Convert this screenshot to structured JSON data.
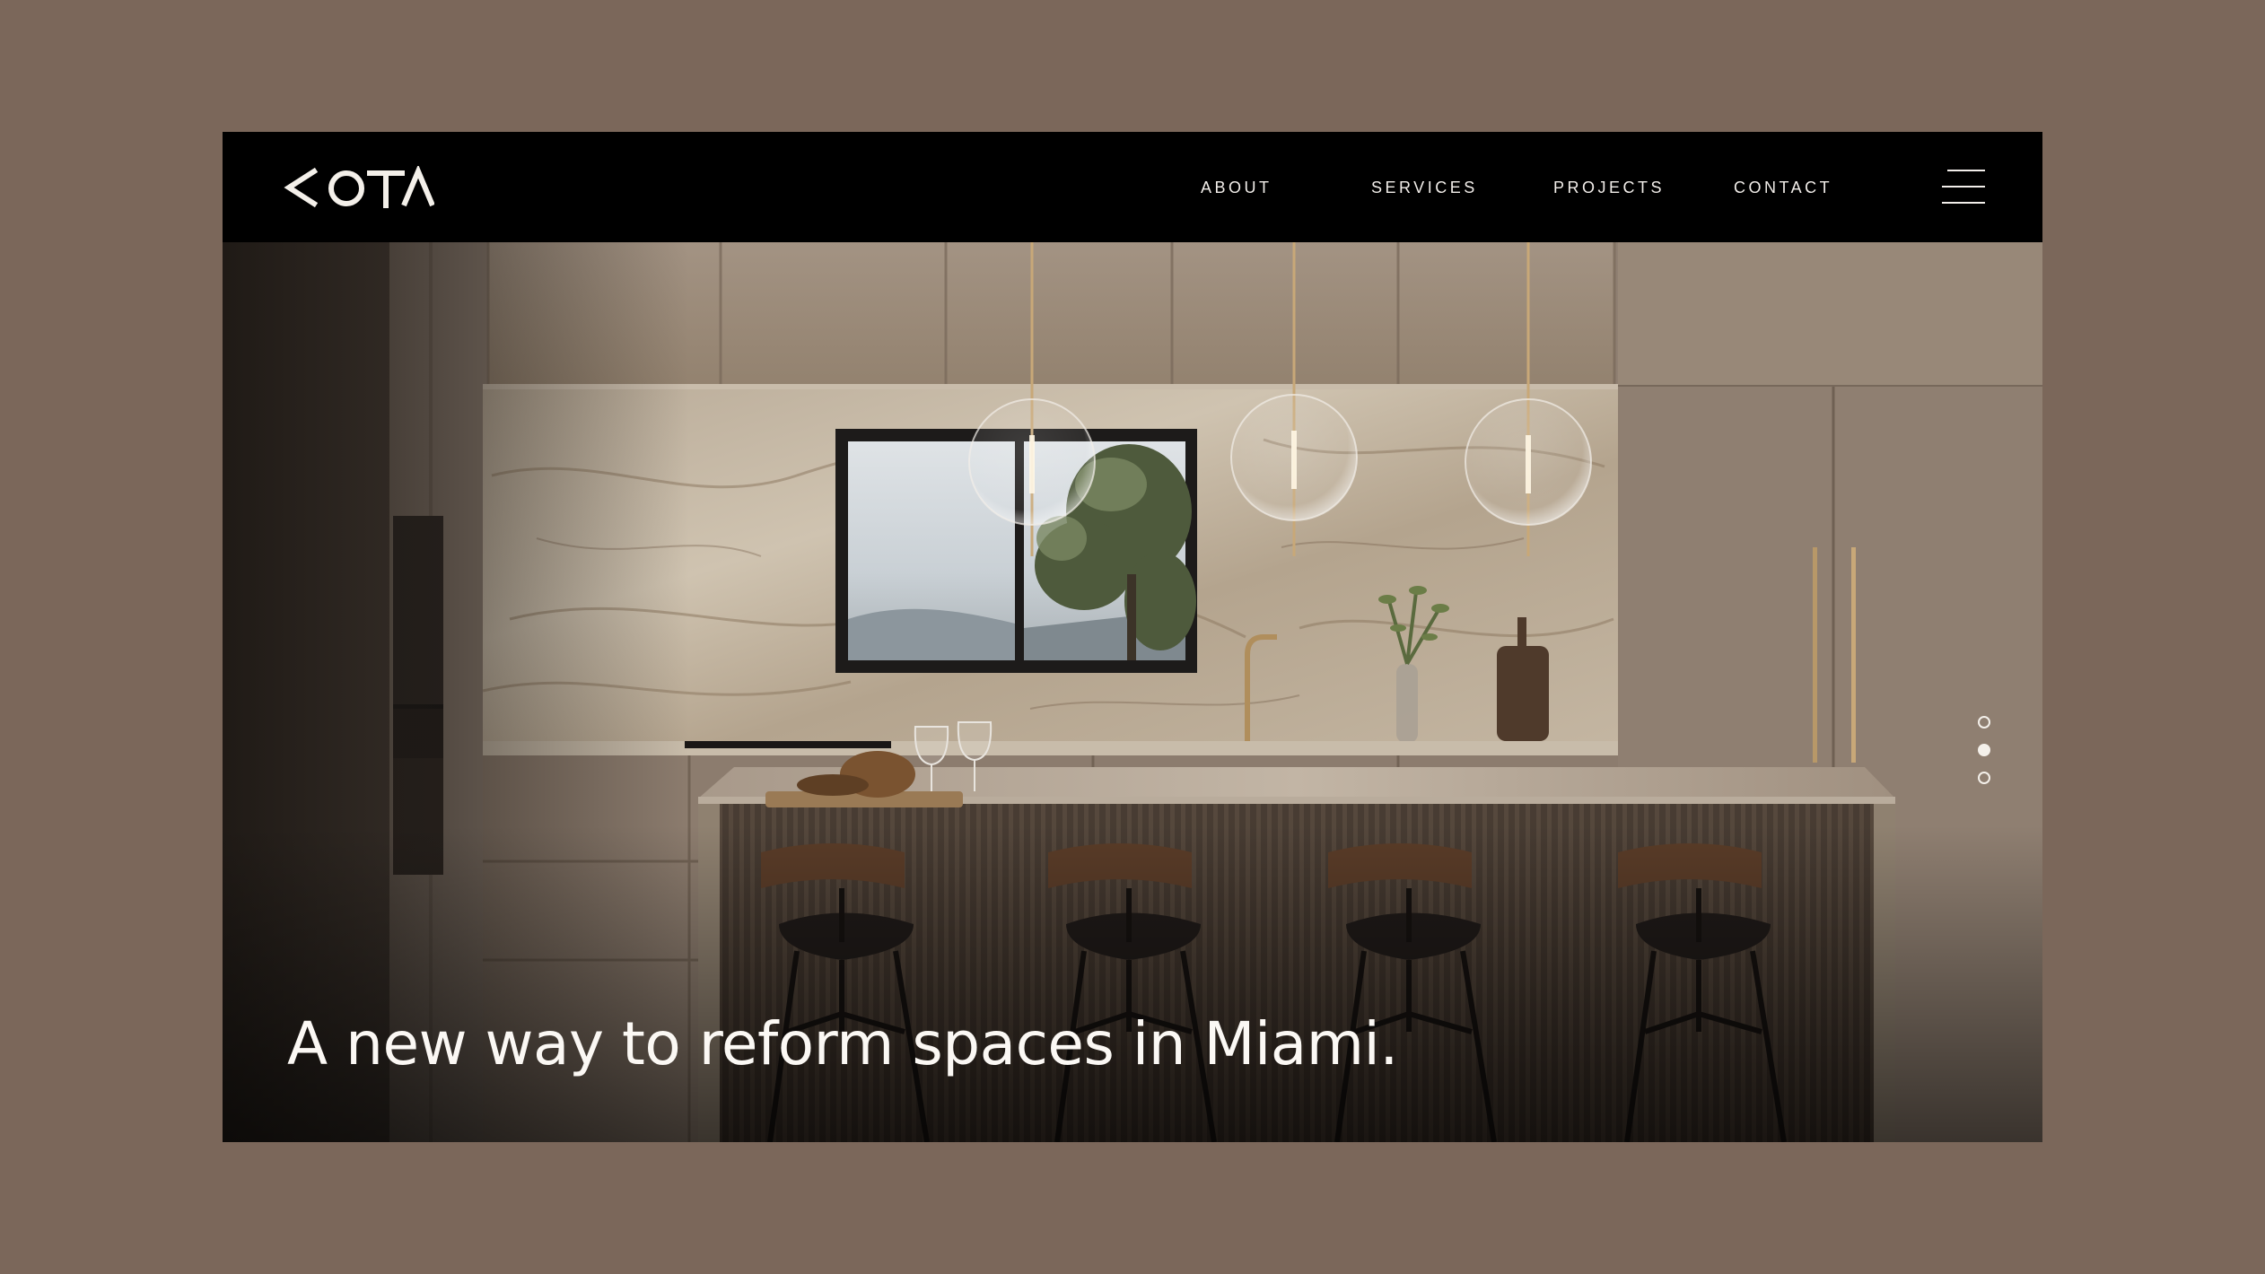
{
  "brand": {
    "logo_text": "COTA"
  },
  "nav": {
    "links": [
      {
        "label": "ABOUT"
      },
      {
        "label": "SERVICES"
      },
      {
        "label": "PROJECTS"
      },
      {
        "label": "CONTACT"
      }
    ],
    "menu_icon": "hamburger-menu-icon"
  },
  "hero": {
    "headline": "A new way to reform spaces in Miami.",
    "image": "kitchen-interior-photo",
    "slides": {
      "count": 3,
      "active_index": 1
    }
  },
  "colors": {
    "page_background": "#7b675a",
    "nav_background": "#000000",
    "text_light": "#f2eeea"
  }
}
